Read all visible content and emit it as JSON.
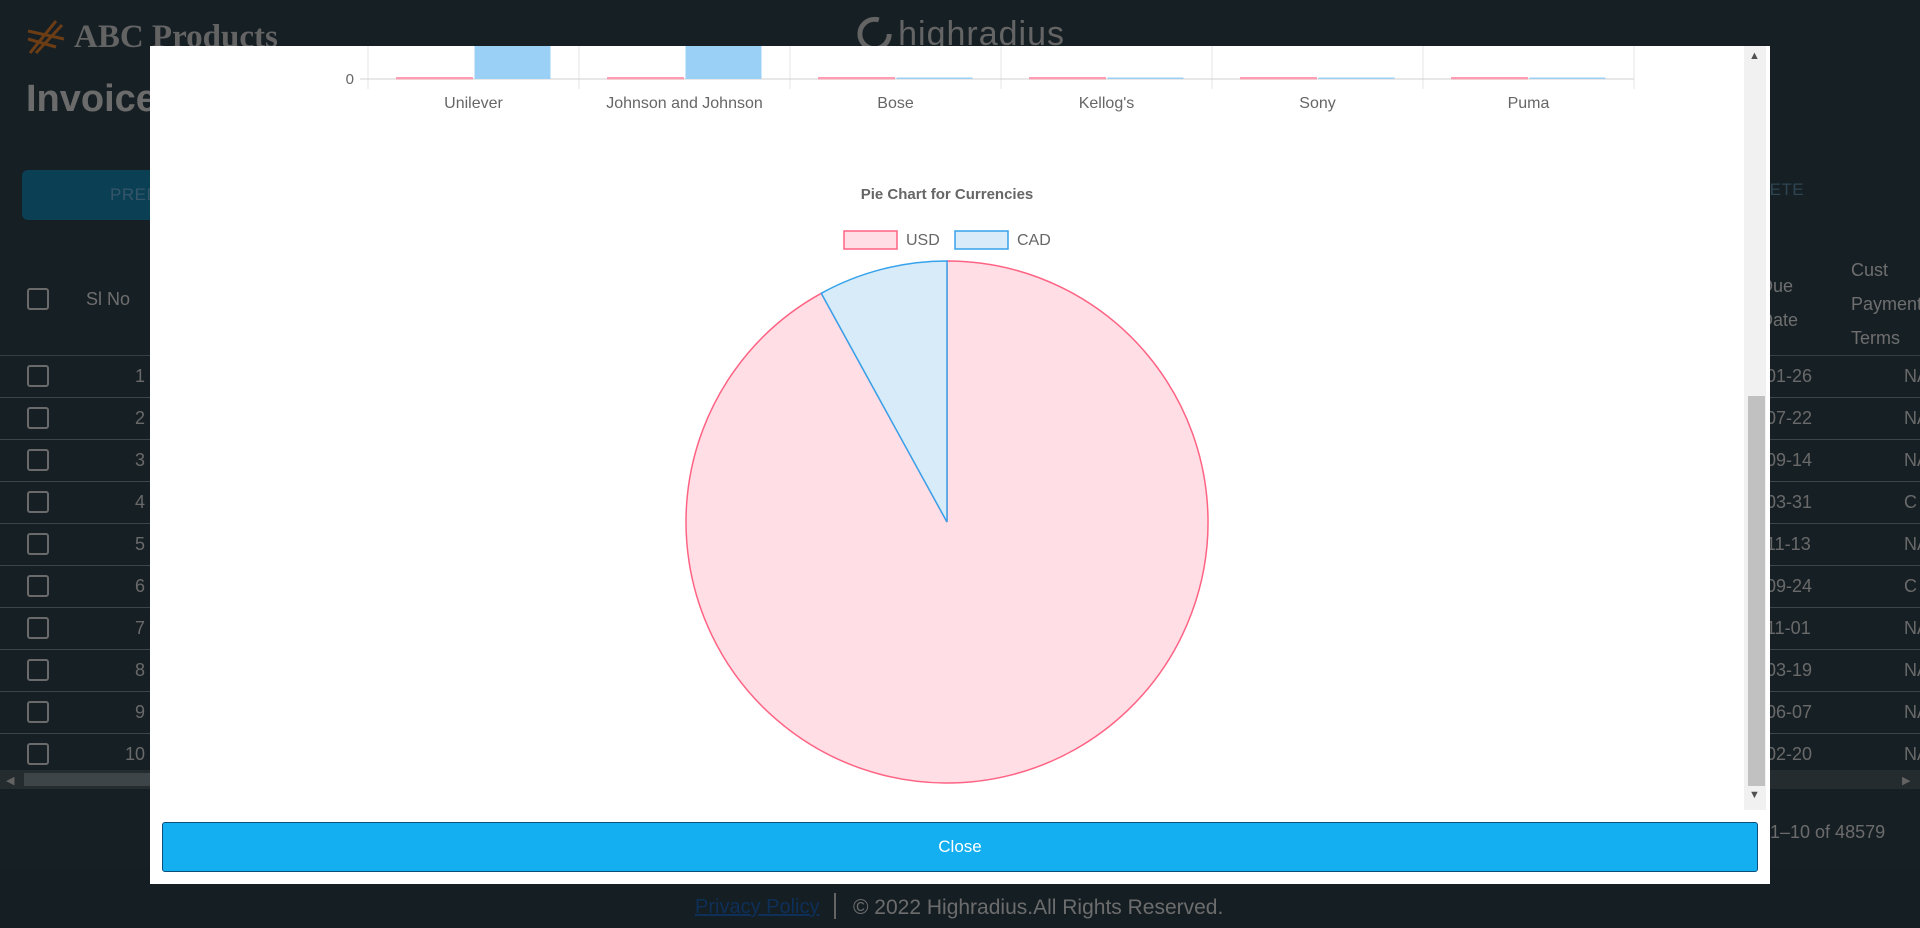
{
  "header": {
    "brand_name": "ABC Products",
    "partner_logo_text": "highradius",
    "page_title": "Invoice"
  },
  "toolbar": {
    "predict_label": "PREDICT",
    "delete_label": "DELETE"
  },
  "table": {
    "columns": {
      "sl_no": "Sl No",
      "due_date_line1": "Due",
      "due_date_line2": "Date",
      "terms_line1": "Cust",
      "terms_line2": "Payment",
      "terms_line3": "Terms"
    },
    "rows": [
      {
        "sl": "1",
        "due": "01-26",
        "terms": "NA"
      },
      {
        "sl": "2",
        "due": "07-22",
        "terms": "NA"
      },
      {
        "sl": "3",
        "due": "09-14",
        "terms": "NA"
      },
      {
        "sl": "4",
        "due": "03-31",
        "terms": "C"
      },
      {
        "sl": "5",
        "due": "11-13",
        "terms": "NA"
      },
      {
        "sl": "6",
        "due": "09-24",
        "terms": "C"
      },
      {
        "sl": "7",
        "due": "11-01",
        "terms": "NA"
      },
      {
        "sl": "8",
        "due": "03-19",
        "terms": "NA"
      },
      {
        "sl": "9",
        "due": "06-07",
        "terms": "NA"
      },
      {
        "sl": "10",
        "due": "02-20",
        "terms": "NA"
      }
    ]
  },
  "pagination": {
    "range_label": "1–10 of 48579"
  },
  "footer": {
    "privacy_label": "Privacy Policy",
    "copyright": "© 2022 Highradius.All Rights Reserved."
  },
  "modal": {
    "close_label": "Close"
  },
  "chart_data": [
    {
      "type": "bar",
      "partially_visible": true,
      "categories": [
        "Unilever",
        "Johnson and Johnson",
        "Bose",
        "Kellog's",
        "Sony",
        "Puma"
      ],
      "series": [
        {
          "values": [
            0,
            0,
            0,
            0,
            0,
            0
          ],
          "color": "#ff6384"
        },
        {
          "values": [
            1,
            1,
            0.002,
            0.001,
            0.001,
            0.004
          ],
          "color": "#36a2eb"
        }
      ],
      "ytick_visible": "0",
      "grid": true
    },
    {
      "type": "pie",
      "title": "Pie Chart for Currencies",
      "legend_position": "top",
      "labels": [
        "USD",
        "CAD"
      ],
      "values": [
        92,
        8
      ],
      "colors": {
        "USD": {
          "fill": "#ffdfe5",
          "stroke": "#ff6384"
        },
        "CAD": {
          "fill": "#d7ebf9",
          "stroke": "#36a2eb"
        }
      }
    }
  ]
}
